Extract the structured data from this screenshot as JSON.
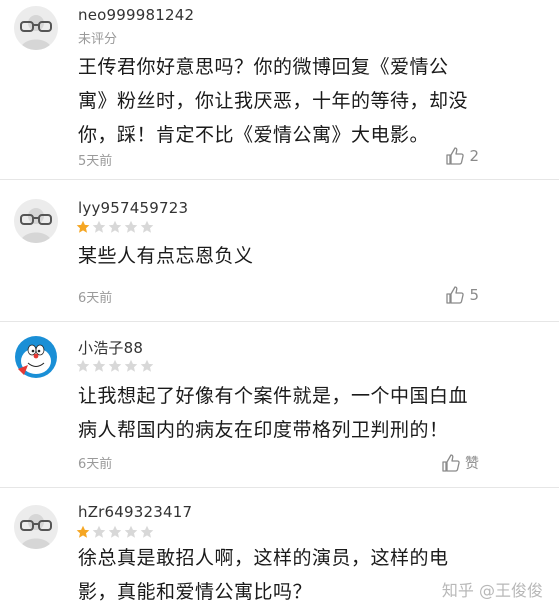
{
  "comments": [
    {
      "username": "neo999981242",
      "rating_label": "未评分",
      "content_lines": [
        "王传君你好意思吗？你的微博回复《爱情公",
        "寓》粉丝时，你让我厌恶，十年的等待，却没",
        "你，踩！肯定不比《爱情公寓》大电影。"
      ],
      "time": "5天前",
      "likes": "2",
      "avatar": "glasses-avatar-icon"
    },
    {
      "username": "lyy957459723",
      "rating": 1,
      "rating_max": 5,
      "content_lines": [
        "某些人有点忘恩负义"
      ],
      "time": "6天前",
      "likes": "5",
      "avatar": "glasses-avatar-icon"
    },
    {
      "username": "小浩子88",
      "rating": 0,
      "rating_max": 5,
      "content_lines": [
        "让我想起了好像有个案件就是，一个中国白血",
        "病人帮国内的病友在印度带格列卫判刑的！"
      ],
      "time": "6天前",
      "likes": "赞",
      "avatar": "doraemon-avatar-icon"
    },
    {
      "username": "hZr649323417",
      "rating": 1,
      "rating_max": 5,
      "content_lines": [
        "徐总真是敢招人啊，这样的演员，这样的电",
        "影，真能和爱情公寓比吗？"
      ],
      "avatar": "glasses-avatar-icon"
    }
  ],
  "watermark": "知乎 @王俊俊",
  "colors": {
    "star_filled": "#f5a623",
    "star_empty": "#d8d8d8",
    "meta_text": "#9a9a9a",
    "divider": "#e6e6e6"
  }
}
